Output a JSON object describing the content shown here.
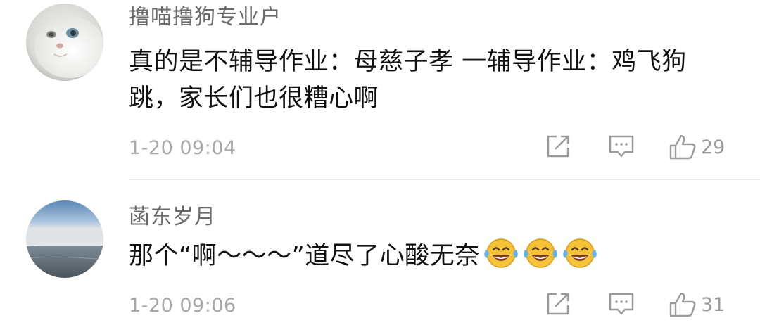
{
  "comments": [
    {
      "username": "撸喵撸狗专业户",
      "text": "真的是不辅导作业：母慈子孝 一辅导作业：鸡飞狗跳，家长们也很糟心啊",
      "timestamp": "1-20 09:04",
      "likes": "29",
      "avatar_icon": "white-cat-avatar"
    },
    {
      "username": "菡东岁月",
      "text": "那个“啊～～～”道尽了心酸无奈",
      "emoji_icon": "laughing-tears-emoji",
      "emoji_count": 3,
      "timestamp": "1-20 09:06",
      "likes": "31",
      "avatar_icon": "seascape-avatar"
    }
  ],
  "icons": {
    "share": "share-icon",
    "reply": "comment-icon",
    "like": "thumbs-up-icon"
  },
  "colors": {
    "username": "#6b6b6b",
    "text": "#111111",
    "meta": "#a8a8a8",
    "icon": "#9a9a9a"
  }
}
